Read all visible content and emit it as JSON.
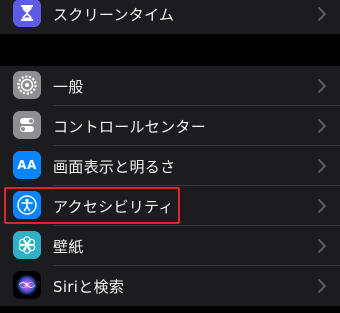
{
  "top_group": {
    "items": [
      {
        "label": "スクリーンタイム",
        "icon": "hourglass-icon",
        "color": "#5e5ce6"
      }
    ]
  },
  "main_group": {
    "items": [
      {
        "label": "一般",
        "icon": "gear-icon",
        "color": "#8e8e93"
      },
      {
        "label": "コントロールセンター",
        "icon": "toggles-icon",
        "color": "#8e8e93"
      },
      {
        "label": "画面表示と明るさ",
        "icon": "text-size-icon",
        "color": "#0a84ff",
        "icon_text": "AA"
      },
      {
        "label": "アクセシビリティ",
        "icon": "accessibility-icon",
        "color": "#0a84ff",
        "highlighted": true
      },
      {
        "label": "壁紙",
        "icon": "flower-icon",
        "color": "#30b0c7"
      },
      {
        "label": "Siriと検索",
        "icon": "siri-icon",
        "color": "#000000"
      }
    ]
  },
  "highlight_color": "#e0242a"
}
